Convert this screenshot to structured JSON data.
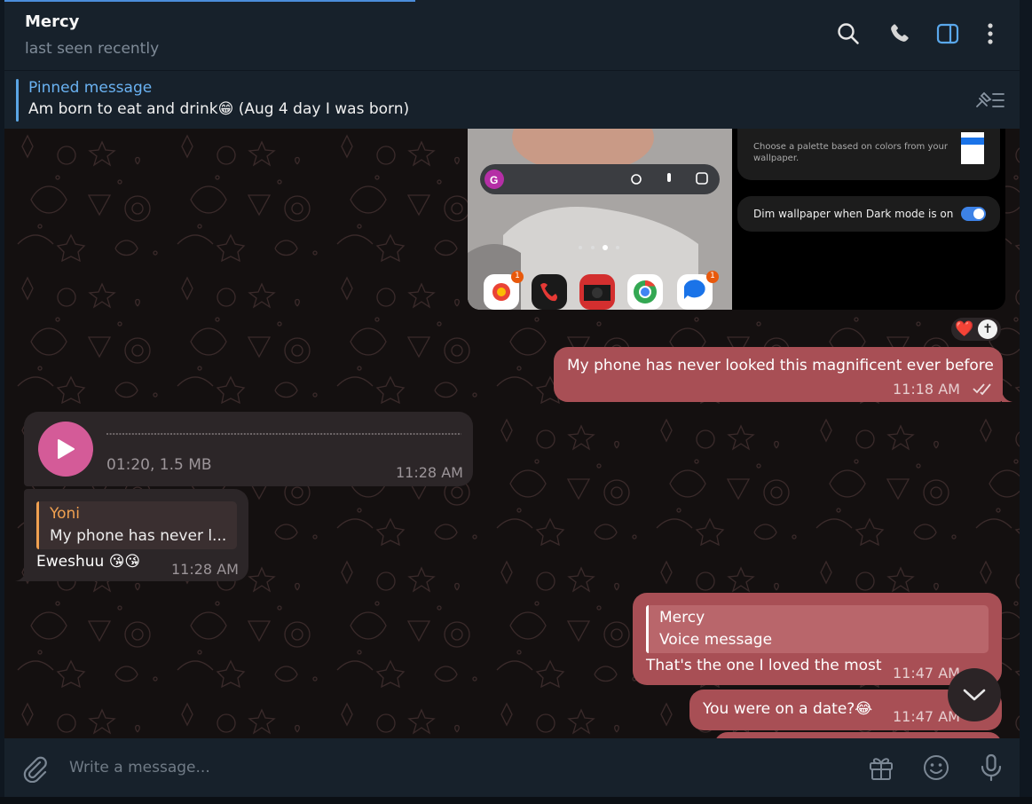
{
  "header": {
    "title": "Mercy",
    "subtitle": "last seen recently"
  },
  "pinned": {
    "title": "Pinned message",
    "text": "Am born to eat and drink😁 (Aug 4 day I was born)"
  },
  "media": {
    "settings_text_1": "Choose a palette based on colors from your",
    "settings_text_2": "wallpaper.",
    "settings_dim": "Dim wallpaper when Dark mode is on",
    "badge_1": "1",
    "badge_2": "1"
  },
  "messages": [
    {
      "id": "m1",
      "text": "My phone has never looked this magnificent ever before",
      "time": "11:18 AM",
      "reactions": [
        "❤️",
        "✝"
      ]
    },
    {
      "id": "m2",
      "duration": "01:20, 1.5 MB",
      "time": "11:28 AM"
    },
    {
      "id": "m3",
      "reply_name": "Yoni",
      "reply_text": "My phone has never l...",
      "text": "Eweshuu 😘😘",
      "time": "11:28 AM"
    },
    {
      "id": "m4",
      "reply_name": "Mercy",
      "reply_text": "Voice message",
      "text": "That's the one I loved the most",
      "time": "11:47 AM"
    },
    {
      "id": "m5",
      "text": "You were on a date?😂",
      "time": "11:47 AM"
    }
  ],
  "composer": {
    "placeholder": "Write a message..."
  },
  "colors": {
    "accent": "#6ab2f2",
    "outgoing_bubble": "#a84f55",
    "incoming_bubble": "#2c2628",
    "voice_play": "#d45b98",
    "reply_name_in": "#f0a050"
  }
}
